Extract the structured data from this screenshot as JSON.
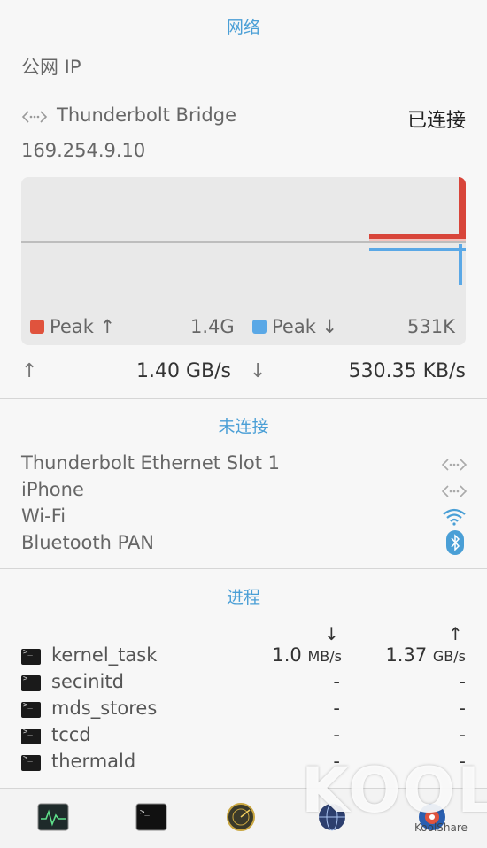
{
  "network": {
    "section_title": "网络",
    "public_ip_label": "公网 IP",
    "interface": {
      "name": "Thunderbolt Bridge",
      "status": "已连接",
      "ip": "169.254.9.10"
    },
    "legend": {
      "upload_label": "Peak ↑",
      "upload_value": "1.4G",
      "download_label": "Peak ↓",
      "download_value": "531K",
      "upload_color": "#e0533d",
      "download_color": "#5aa8e6"
    },
    "speed": {
      "up_arrow": "↑",
      "up_value": "1.40 GB/s",
      "down_arrow": "↓",
      "down_value": "530.35 KB/s"
    }
  },
  "disconnected": {
    "section_title": "未连接",
    "items": [
      {
        "name": "Thunderbolt Ethernet Slot 1",
        "icon": "ethernet-icon"
      },
      {
        "name": "iPhone",
        "icon": "ethernet-icon"
      },
      {
        "name": "Wi-Fi",
        "icon": "wifi-icon"
      },
      {
        "name": "Bluetooth PAN",
        "icon": "bluetooth-icon"
      }
    ]
  },
  "processes": {
    "section_title": "进程",
    "col_down_arrow": "↓",
    "col_up_arrow": "↑",
    "rows": [
      {
        "name": "kernel_task",
        "down": "1.0",
        "down_unit": "MB/s",
        "up": "1.37",
        "up_unit": "GB/s"
      },
      {
        "name": "secinitd",
        "down": "-",
        "down_unit": "",
        "up": "-",
        "up_unit": ""
      },
      {
        "name": "mds_stores",
        "down": "-",
        "down_unit": "",
        "up": "-",
        "up_unit": ""
      },
      {
        "name": "tccd",
        "down": "-",
        "down_unit": "",
        "up": "-",
        "up_unit": ""
      },
      {
        "name": "thermald",
        "down": "-",
        "down_unit": "",
        "up": "-",
        "up_unit": ""
      }
    ]
  },
  "watermark": {
    "big": "KOOL",
    "small": "KoolShare"
  }
}
